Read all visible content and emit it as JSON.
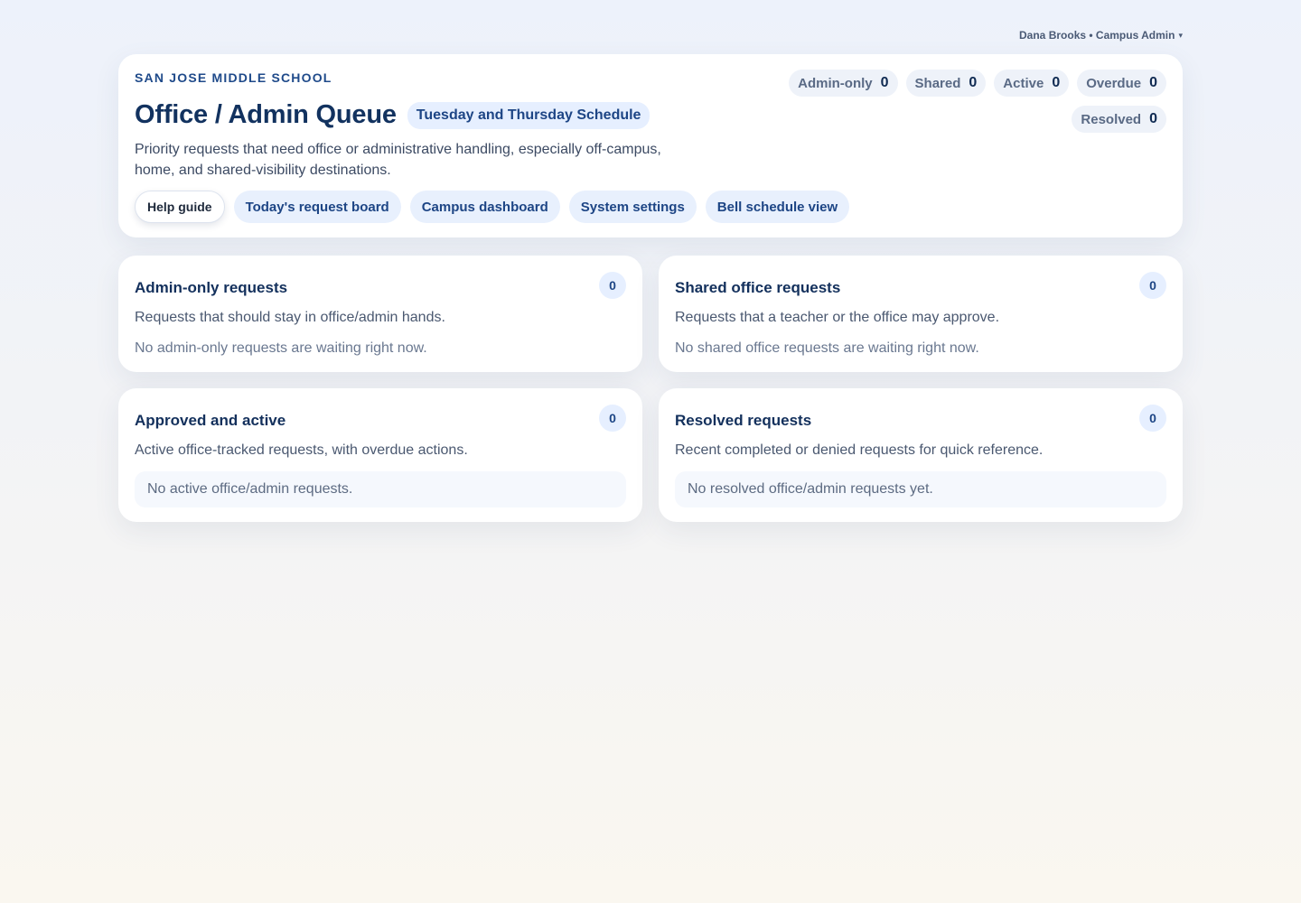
{
  "user": {
    "label": "Dana Brooks • Campus Admin",
    "caret": "▾"
  },
  "school": "SAN JOSE MIDDLE SCHOOL",
  "title": "Office / Admin Queue",
  "schedule": "Tuesday and Thursday Schedule",
  "description": "Priority requests that need office or administrative handling, especially off-campus, home, and shared-visibility destinations.",
  "actions": {
    "help": "Help guide",
    "board": "Today's request board",
    "dashboard": "Campus dashboard",
    "settings": "System settings",
    "bell": "Bell schedule view"
  },
  "stats": [
    {
      "label": "Admin-only",
      "value": "0"
    },
    {
      "label": "Shared",
      "value": "0"
    },
    {
      "label": "Active",
      "value": "0"
    },
    {
      "label": "Overdue",
      "value": "0"
    },
    {
      "label": "Resolved",
      "value": "0"
    }
  ],
  "cards": {
    "admin": {
      "title": "Admin-only requests",
      "count": "0",
      "description": "Requests that should stay in office/admin hands.",
      "empty": "No admin-only requests are waiting right now."
    },
    "shared": {
      "title": "Shared office requests",
      "count": "0",
      "description": "Requests that a teacher or the office may approve.",
      "empty": "No shared office requests are waiting right now."
    },
    "active": {
      "title": "Approved and active",
      "count": "0",
      "description": "Active office-tracked requests, with overdue actions.",
      "empty": "No active office/admin requests."
    },
    "resolved": {
      "title": "Resolved requests",
      "count": "0",
      "description": "Recent completed or denied requests for quick reference.",
      "empty": "No resolved office/admin requests yet."
    }
  }
}
